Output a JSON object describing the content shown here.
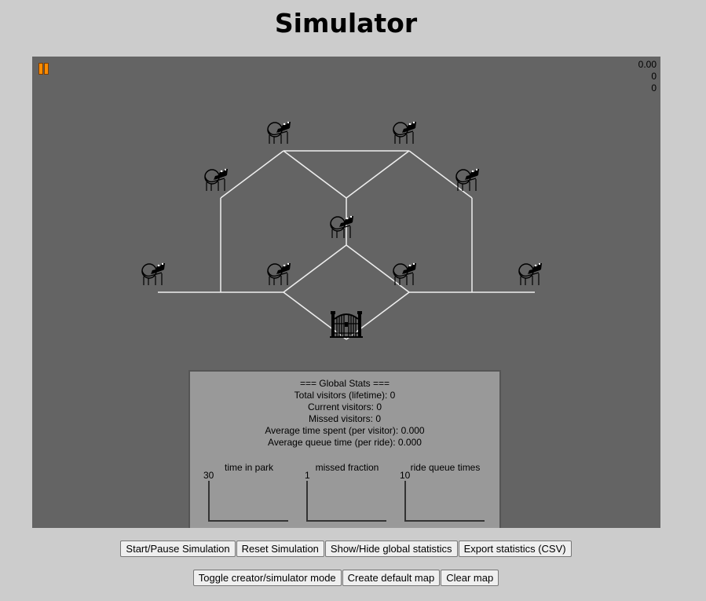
{
  "page": {
    "title": "Simulator"
  },
  "hud": {
    "time": "0.00",
    "line2": "0",
    "line3": "0"
  },
  "status": {
    "state": "paused",
    "pause_icon_color": "#ff8c00"
  },
  "colors": {
    "canvas_bg": "#646464",
    "path": "#eeeeee",
    "panel_bg": "#999999",
    "page_bg": "#cccccc"
  },
  "map": {
    "rides": [
      {
        "icon": "roller-coaster-icon"
      },
      {
        "icon": "roller-coaster-icon"
      },
      {
        "icon": "roller-coaster-icon"
      },
      {
        "icon": "roller-coaster-icon"
      },
      {
        "icon": "roller-coaster-icon"
      },
      {
        "icon": "roller-coaster-icon"
      },
      {
        "icon": "roller-coaster-icon"
      },
      {
        "icon": "roller-coaster-icon"
      },
      {
        "icon": "roller-coaster-icon"
      }
    ],
    "entrance": {
      "icon": "park-gate-icon"
    }
  },
  "stats": {
    "header": "=== Global Stats ===",
    "total_visitors": "Total visitors (lifetime): 0",
    "current_visitors": "Current visitors: 0",
    "missed_visitors": "Missed visitors: 0",
    "avg_time_spent": "Average time spent (per visitor): 0.000",
    "avg_queue_time": "Average queue time (per ride): 0.000",
    "charts": [
      {
        "title": "time in park",
        "max": "30"
      },
      {
        "title": "missed fraction",
        "max": "1"
      },
      {
        "title": "ride queue times",
        "max": "10"
      }
    ]
  },
  "buttons": {
    "row1": [
      "Start/Pause Simulation",
      "Reset Simulation",
      "Show/Hide global statistics",
      "Export statistics (CSV)"
    ],
    "row2": [
      "Toggle creator/simulator mode",
      "Create default map",
      "Clear map"
    ]
  }
}
